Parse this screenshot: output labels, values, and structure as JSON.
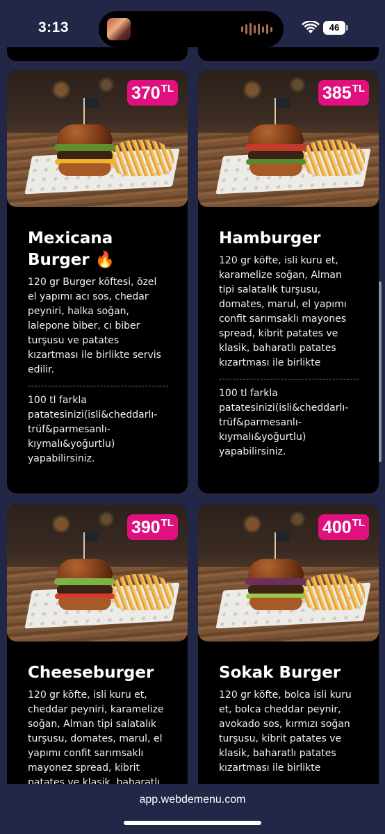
{
  "status_bar": {
    "time": "3:13",
    "battery": "46"
  },
  "menu": {
    "currency": "TL",
    "items": [
      {
        "name": "Mexicana Burger 🔥",
        "price": "370",
        "description": "120 gr Burger köftesi, özel el yapımı acı sos, chedar peyniri, halka soğan, lalepone biber, cı biber turşusu ve patates kızartması ile birlikte servis edilir.",
        "note": "100 tl farkla patatesinizi(isli&cheddarlı-trüf&parmesanlı-kıymalı&yoğurtlu) yapabilirsiniz.",
        "topping_color": "#5e8f2a"
      },
      {
        "name": "Hamburger",
        "price": "385",
        "description": "120 gr köfte, isli kuru et, karamelize soğan, Alman tipi salatalık turşusu, domates, marul, el yapımı confit sarımsaklı mayones spread, kibrit patates ve klasik, baharatlı patates kızartması ile birlikte",
        "note": "100 tl farkla patatesinizi(isli&cheddarlı-trüf&parmesanlı-kıymalı&yoğurtlu) yapabilirsiniz.",
        "topping_color": "#c23b2a"
      },
      {
        "name": "Cheeseburger",
        "price": "390",
        "description": "120 gr köfte, isli kuru et, cheddar peyniri, karamelize soğan, Alman tipi salatalık turşusu, domates, marul, el yapımı confit sarımsaklı mayonez spread, kibrit patates ve klasik, baharatlı",
        "topping_color": "#7db343"
      },
      {
        "name": "Sokak Burger",
        "price": "400",
        "description": "120 gr köfte, bolca isli kuru et, bolca cheddar peynir, avokado sos, kırmızı soğan turşusu, kibrit patates ve klasik, baharatlı patates kızartması ile birlikte",
        "topping_color": "#6b2f5a"
      }
    ]
  },
  "browser": {
    "url": "app.webdemenu.com"
  }
}
